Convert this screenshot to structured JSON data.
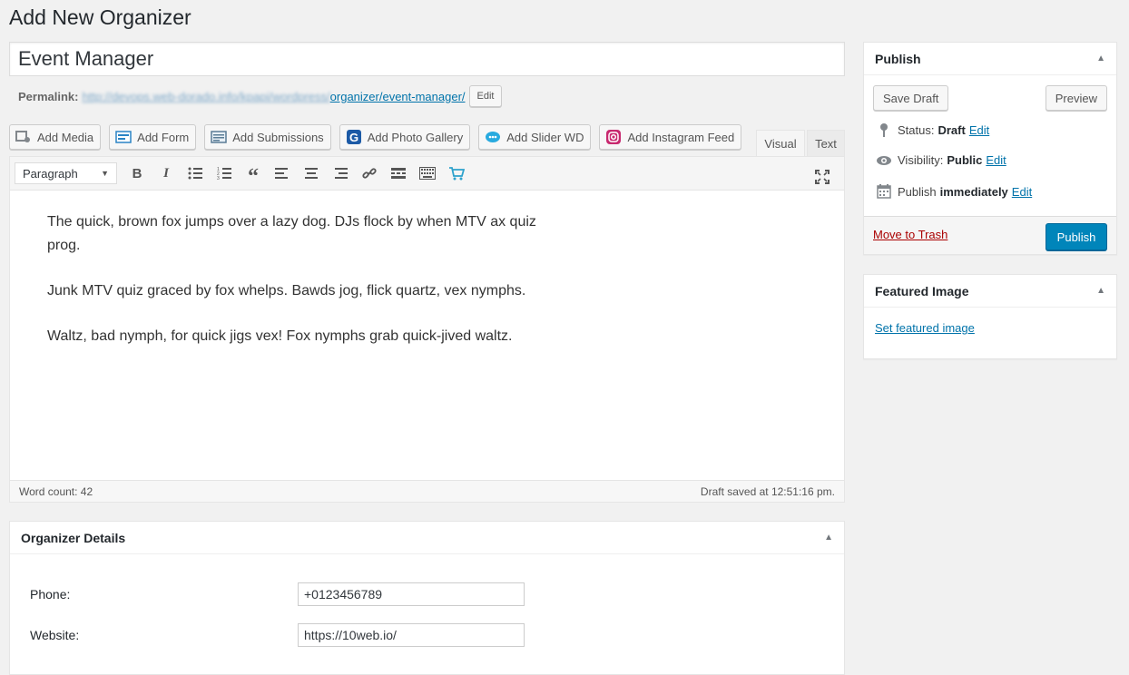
{
  "page": {
    "title": "Add New Organizer"
  },
  "post": {
    "title": "Event Manager",
    "permalink_label": "Permalink:",
    "permalink_base": "http://devops.web-dorado.info/kpapi/wordpress/",
    "permalink_slug": "organizer/event-manager/",
    "permalink_edit": "Edit"
  },
  "media_buttons": [
    {
      "label": "Add Media",
      "icon": "media-icon"
    },
    {
      "label": "Add Form",
      "icon": "form-icon"
    },
    {
      "label": "Add Submissions",
      "icon": "submissions-icon"
    },
    {
      "label": "Add Photo Gallery",
      "icon": "gallery-icon"
    },
    {
      "label": "Add Slider WD",
      "icon": "slider-icon"
    },
    {
      "label": "Add Instagram Feed",
      "icon": "instagram-icon"
    }
  ],
  "editor_tabs": {
    "visual": "Visual",
    "text": "Text"
  },
  "toolbar": {
    "format": "Paragraph"
  },
  "content": {
    "p1": "The quick, brown fox jumps over a lazy dog. DJs flock by when MTV ax quiz prog.",
    "p2": "Junk MTV quiz graced by fox whelps. Bawds jog, flick quartz, vex nymphs.",
    "p3": "Waltz, bad nymph, for quick jigs vex! Fox nymphs grab quick-jived waltz."
  },
  "status": {
    "word_count": "Word count: 42",
    "draft_saved": "Draft saved at 12:51:16 pm."
  },
  "organizer_details": {
    "title": "Organizer Details",
    "phone_label": "Phone:",
    "phone_value": "+0123456789",
    "website_label": "Website:",
    "website_value": "https://10web.io/"
  },
  "publish": {
    "title": "Publish",
    "save_draft": "Save Draft",
    "preview": "Preview",
    "status_label": "Status:",
    "status_value": "Draft",
    "visibility_label": "Visibility:",
    "visibility_value": "Public",
    "publish_label": "Publish",
    "publish_value": "immediately",
    "edit": "Edit",
    "trash": "Move to Trash",
    "publish_button": "Publish"
  },
  "featured_image": {
    "title": "Featured Image",
    "link": "Set featured image"
  },
  "colors": {
    "accent": "#0085ba",
    "link": "#0073aa",
    "trash": "#a00000"
  }
}
